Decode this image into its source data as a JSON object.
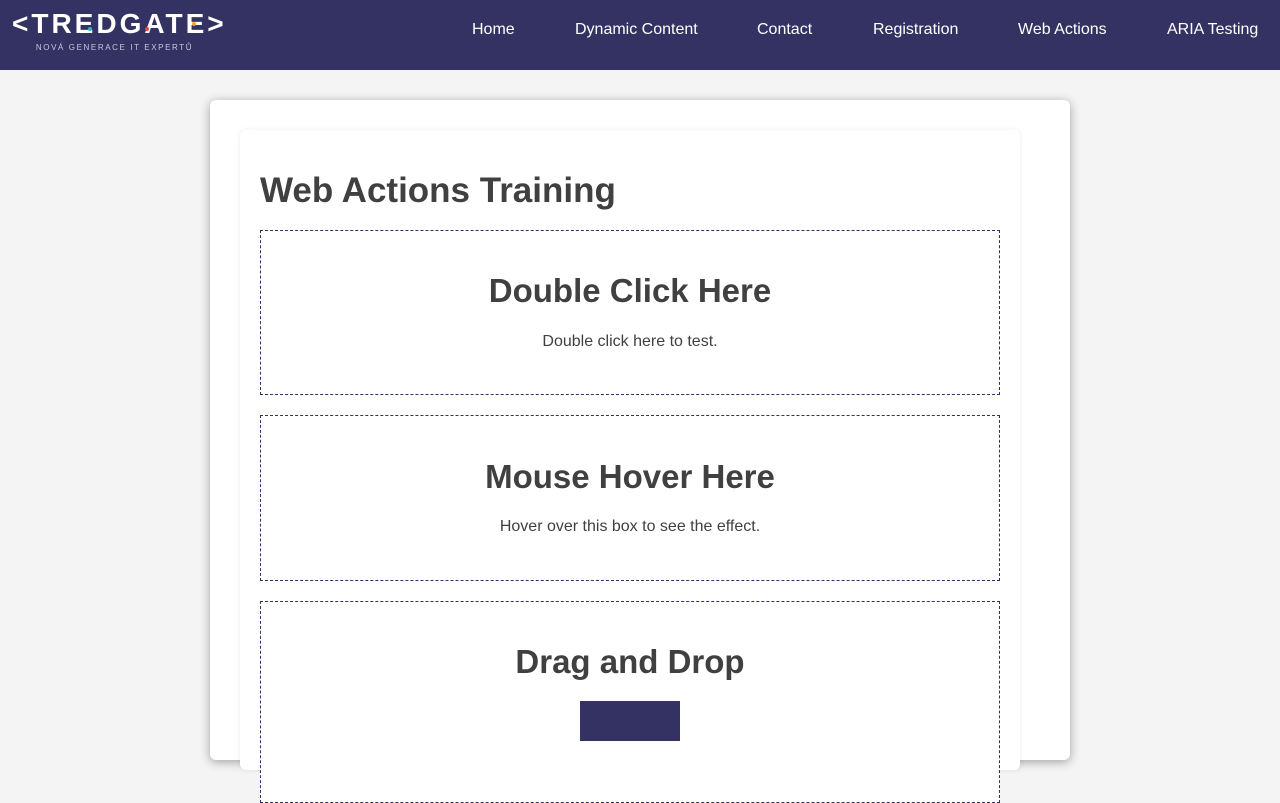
{
  "header": {
    "logo_text": "<TREDGATE>",
    "logo_subtitle": "NOVÁ GENERACE IT EXPERTŮ",
    "nav": [
      {
        "label": "Home"
      },
      {
        "label": "Dynamic Content"
      },
      {
        "label": "Contact"
      },
      {
        "label": "Registration"
      },
      {
        "label": "Web Actions"
      },
      {
        "label": "ARIA Testing"
      }
    ]
  },
  "main": {
    "title": "Web Actions Training",
    "sections": [
      {
        "title": "Double Click Here",
        "text": "Double click here to test."
      },
      {
        "title": "Mouse Hover Here",
        "text": "Hover over this box to see the effect."
      },
      {
        "title": "Drag and Drop"
      }
    ]
  },
  "colors": {
    "brand": "#343262",
    "text": "#404040",
    "background": "#f4f4f4",
    "logo_accents": [
      "#2bb3c8",
      "#e8473c",
      "#f5a623"
    ]
  }
}
